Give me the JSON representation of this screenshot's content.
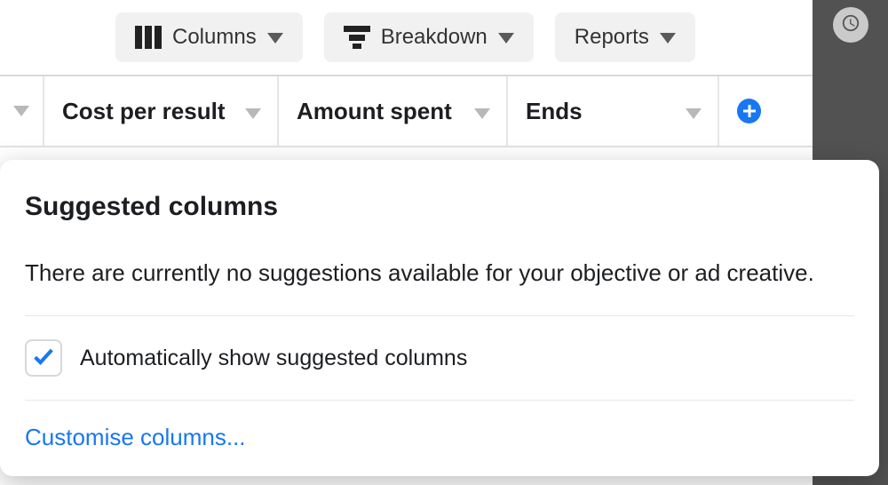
{
  "toolbar": {
    "columns_label": "Columns",
    "breakdown_label": "Breakdown",
    "reports_label": "Reports"
  },
  "table": {
    "headers": {
      "cost_per_result": "Cost per result",
      "amount_spent": "Amount spent",
      "ends": "Ends"
    }
  },
  "popover": {
    "title": "Suggested columns",
    "message": "There are currently no suggestions available for your objective or ad creative.",
    "auto_show_label": "Automatically show suggested columns",
    "customise_label": "Customise columns..."
  }
}
